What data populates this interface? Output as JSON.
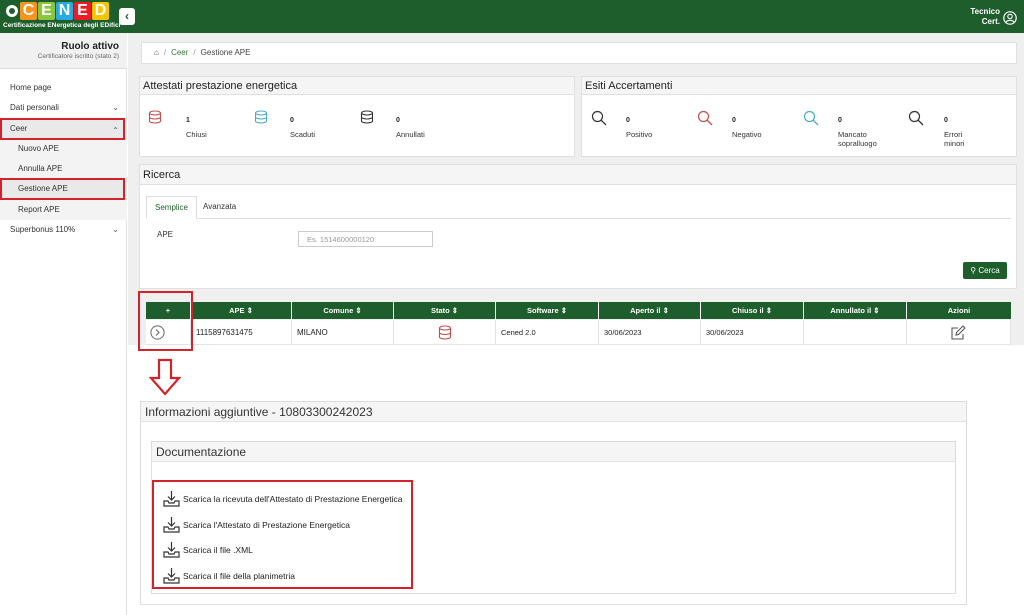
{
  "header": {
    "logo_letters": [
      "C",
      "E",
      "N",
      "E",
      "D"
    ],
    "logo_tagline": "Certificazione ENergetica degli EDifici",
    "user_line1": "Tecnico",
    "user_line2": "Cert.",
    "collapse_glyph": "‹",
    "colors": {
      "bar": "#1e5e2c",
      "letter_c": "#f7941d",
      "letter_e": "#8cc63f",
      "letter_n": "#29abe2",
      "letter_e2": "#ed1c24",
      "letter_d": "#f7c600"
    }
  },
  "sidebar": {
    "role_title": "Ruolo attivo",
    "role_sub": "Certificatore iscritto (stato 2)",
    "items": [
      {
        "label": "Home page"
      },
      {
        "label": "Dati personali",
        "chevron": "⌄"
      },
      {
        "label": "Ceer",
        "chevron": "⌃"
      },
      {
        "label": "Nuovo APE"
      },
      {
        "label": "Annulla APE"
      },
      {
        "label": "Gestione APE"
      },
      {
        "label": "Report APE"
      },
      {
        "label": "Superbonus 110%",
        "chevron": "⌄"
      }
    ]
  },
  "breadcrumb": {
    "home_icon": "home-icon",
    "items": [
      "Ceer",
      "Gestione APE"
    ],
    "separator": "/"
  },
  "attestati": {
    "title": "Attestati prestazione energetica",
    "stats": [
      {
        "value": "1",
        "label": "Chiusi",
        "icon": "database-icon",
        "color": "#c0504d"
      },
      {
        "value": "0",
        "label": "Scaduti",
        "icon": "database-icon",
        "color": "#4bacc6"
      },
      {
        "value": "0",
        "label": "Annullati",
        "icon": "database-icon",
        "color": "#333333"
      }
    ]
  },
  "esiti": {
    "title": "Esiti Accertamenti",
    "stats": [
      {
        "value": "0",
        "label": "Positivo",
        "icon": "search-icon",
        "color": "#333333"
      },
      {
        "value": "0",
        "label": "Negativo",
        "icon": "search-icon",
        "color": "#c0504d"
      },
      {
        "value": "0",
        "label": "Mancato sopralluogo",
        "icon": "search-icon",
        "color": "#4bacc6"
      },
      {
        "value": "0",
        "label": "Errori minori",
        "icon": "search-icon",
        "color": "#333333"
      }
    ]
  },
  "ricerca": {
    "title": "Ricerca",
    "tabs": [
      "Semplice",
      "Avanzata"
    ],
    "field_label": "APE",
    "placeholder": "Es. 1514600000120",
    "button_label": "Cerca"
  },
  "table": {
    "headers": [
      "+",
      "APE ⇕",
      "Comune ⇕",
      "Stato ⇕",
      "Software ⇕",
      "Aperto il ⇕",
      "Chiuso il ⇕",
      "Annullato il ⇕",
      "Azioni"
    ],
    "rows": [
      {
        "ape": "1115897631475",
        "comune": "MILANO",
        "stato": "database-icon",
        "software": "Cened 2.0",
        "aperto": "30/06/2023",
        "chiuso": "30/06/2023",
        "annullato": "",
        "azioni": "edit-icon"
      }
    ]
  },
  "info": {
    "title": "Informazioni aggiuntive - 10803300242023",
    "doc_title": "Documentazione",
    "links": [
      "Scarica la ricevuta dell'Attestato di Prestazione Energetica",
      "Scarica l'Attestato di Prestazione Energetica",
      "Scarica il file .XML",
      "Scarica il file della planimetria"
    ]
  },
  "annotation_color": "#d2232a"
}
